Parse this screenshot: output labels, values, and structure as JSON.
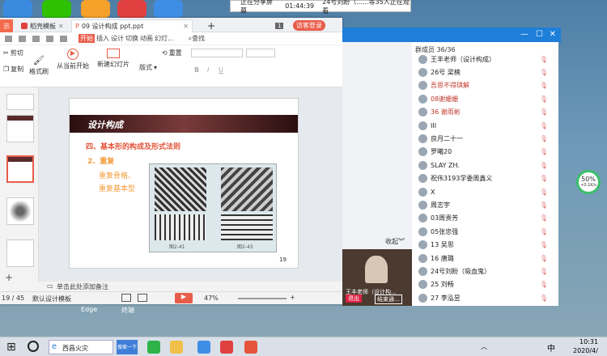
{
  "share_bar": {
    "status": "正在分享屏幕",
    "time": "01:44:39",
    "viewers": "24号刘盼（......等35人正在观看"
  },
  "ppt": {
    "tabs": [
      {
        "label": "示"
      },
      {
        "label": "稻壳模板"
      },
      {
        "label": "09 设计构成  ppt.ppt"
      }
    ],
    "guest_login": "访客登录",
    "menu": [
      "开始",
      "插入",
      "设计",
      "切换",
      "动画",
      "幻灯..."
    ],
    "search": "查找",
    "ribbon": {
      "cut": "剪切",
      "copy": "复制",
      "format_painter": "格式刷",
      "play_from_current": "从当前开始",
      "new_slide": "新建幻灯片",
      "layout": "版式",
      "reset": "重置",
      "bold": "B",
      "italic": "I",
      "underline": "U"
    },
    "slide": {
      "banner": "设计构成",
      "heading1": "四、基本形的构成及形式法则",
      "heading2": "2、重复",
      "item1": "重复骨格、",
      "item2": "重复基本型",
      "caption_left": "图2-41",
      "caption_right": "图2-43",
      "page": "19"
    },
    "notes_placeholder": "单击此处添加备注",
    "status": {
      "page": "19 / 45",
      "template": "默认设计模板",
      "zoom": "47%"
    }
  },
  "chat": {
    "title": "群成员 36/36",
    "members": [
      {
        "name": "王丰老师（设计构成）",
        "color": "#222"
      },
      {
        "name": "26号 梁楠",
        "color": "#222"
      },
      {
        "name": "吾思不得琪解",
        "color": "#c0392b"
      },
      {
        "name": "08谢姗姗",
        "color": "#c0392b"
      },
      {
        "name": "36 谢雨彬",
        "color": "#c0392b"
      },
      {
        "name": "III",
        "color": "#222"
      },
      {
        "name": "良月二十一",
        "color": "#222"
      },
      {
        "name": "罗曦20",
        "color": "#222"
      },
      {
        "name": "SLAY ZH.",
        "color": "#222"
      },
      {
        "name": "祝伟3193学委周鑫义",
        "color": "#222"
      },
      {
        "name": "X",
        "color": "#222"
      },
      {
        "name": "周志宇",
        "color": "#222"
      },
      {
        "name": "03周贵芳",
        "color": "#222"
      },
      {
        "name": "05张忠强",
        "color": "#222"
      },
      {
        "name": "13 吴思",
        "color": "#222"
      },
      {
        "name": "16 唐璐",
        "color": "#222"
      },
      {
        "name": "24号刘盼（吸血鬼）",
        "color": "#222"
      },
      {
        "name": "25 刘畅",
        "color": "#222"
      },
      {
        "name": "27 李泓昱",
        "color": "#222"
      }
    ],
    "collapse": "收起",
    "video_name": "王丰老师（设计构...",
    "exit": "退出",
    "end": "结束通..."
  },
  "gauge": {
    "value": "50%",
    "sub": "+0.1K/s"
  },
  "taskbar": {
    "items": [
      "西昌火灾",
      "搜索一下"
    ],
    "ime": "中",
    "time": "10:31",
    "date": "2020/4/"
  },
  "desktop_labels": [
    "Edge",
    "终端"
  ]
}
